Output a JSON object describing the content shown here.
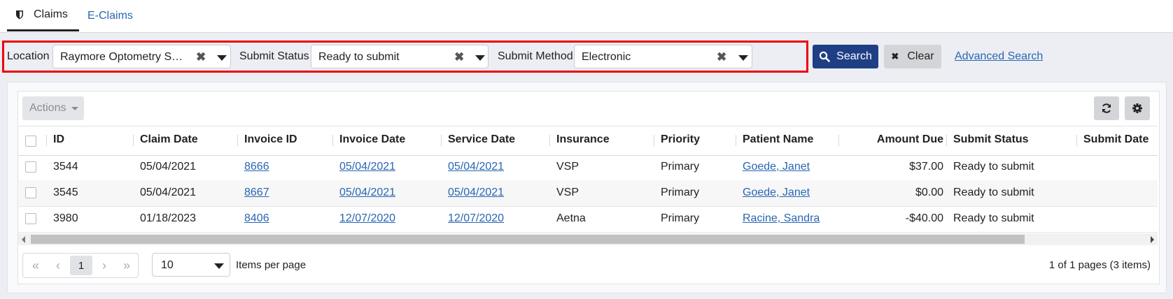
{
  "tabs": [
    {
      "label": "Claims"
    },
    {
      "label": "E-Claims"
    }
  ],
  "filters": {
    "location": {
      "label": "Location",
      "value": "Raymore Optometry Ser..."
    },
    "submit_status": {
      "label": "Submit Status",
      "value": "Ready to submit"
    },
    "submit_method": {
      "label": "Submit Method",
      "value": "Electronic"
    }
  },
  "buttons": {
    "search": "Search",
    "clear": "Clear",
    "advanced": "Advanced Search",
    "actions": "Actions"
  },
  "table": {
    "headers": [
      "ID",
      "Claim Date",
      "Invoice ID",
      "Invoice Date",
      "Service Date",
      "Insurance",
      "Priority",
      "Patient Name",
      "Amount Due",
      "Submit Status",
      "Submit Date"
    ],
    "rows": [
      [
        "3544",
        "05/04/2021",
        "8666",
        "05/04/2021",
        "05/04/2021",
        "VSP",
        "Primary",
        "Goede, Janet",
        "$37.00",
        "Ready to submit"
      ],
      [
        "3545",
        "05/04/2021",
        "8667",
        "05/04/2021",
        "05/04/2021",
        "VSP",
        "Primary",
        "Goede, Janet",
        "$0.00",
        "Ready to submit"
      ],
      [
        "3980",
        "01/18/2023",
        "8406",
        "12/07/2020",
        "12/07/2020",
        "Aetna",
        "Primary",
        "Racine, Sandra",
        "-$40.00",
        "Ready to submit"
      ]
    ]
  },
  "pagination": {
    "current_page": "1",
    "per_page": "10",
    "per_page_label": "Items per page",
    "summary": "1 of 1 pages (3 items)"
  },
  "colors": {
    "primary": "#1f3f85",
    "link": "#2a66b3",
    "highlight": "#e00000"
  }
}
